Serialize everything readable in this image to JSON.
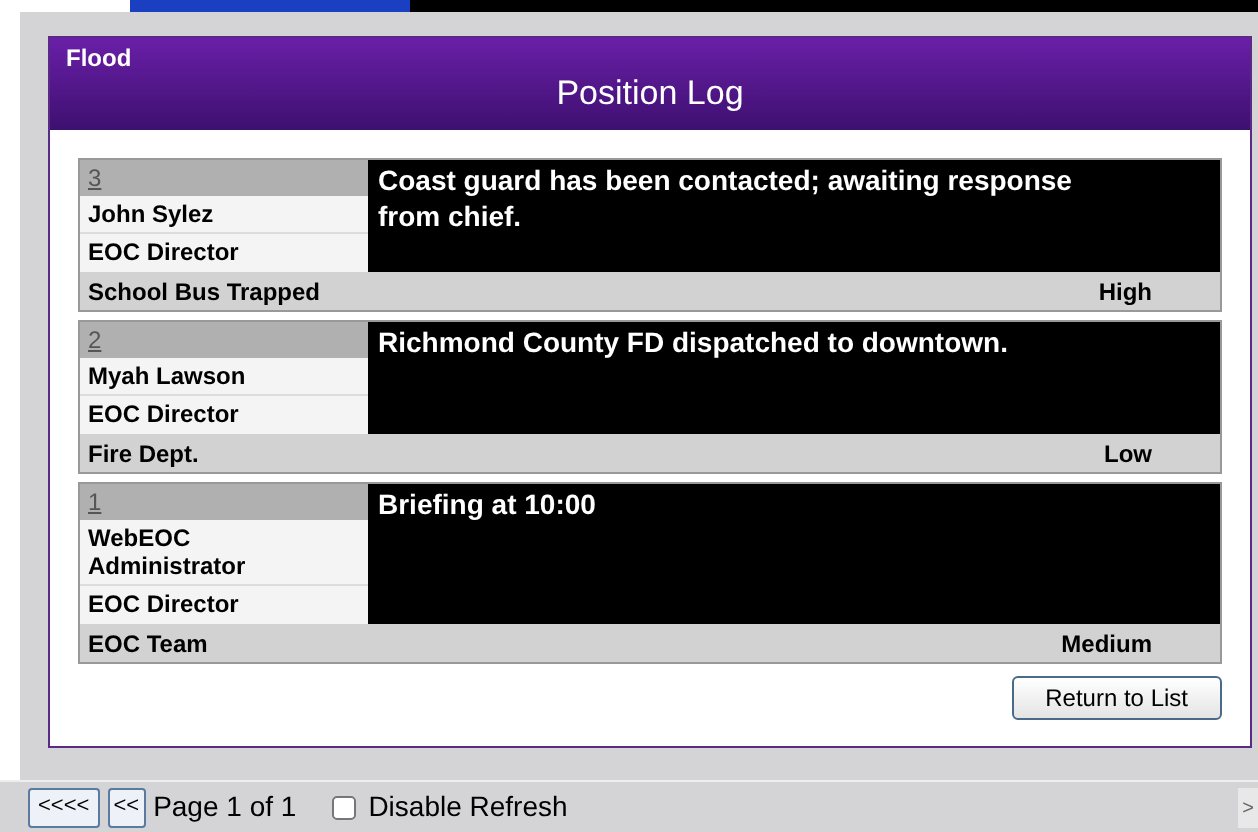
{
  "incident": "Flood",
  "title": "Position Log",
  "entries": [
    {
      "number": "3",
      "name": "John Sylez",
      "role": "EOC Director",
      "message": "Coast guard has been contacted; awaiting response from chief.",
      "category": "School Bus Trapped",
      "priority": "High"
    },
    {
      "number": "2",
      "name": "Myah Lawson",
      "role": "EOC Director",
      "message": "Richmond County FD dispatched to downtown.",
      "category": "Fire Dept.",
      "priority": "Low"
    },
    {
      "number": "1",
      "name": "WebEOC Administrator",
      "role": "EOC Director",
      "message": "Briefing at 10:00",
      "category": "EOC Team",
      "priority": "Medium"
    }
  ],
  "return_button": "Return to List",
  "pager": {
    "first": "<<<<",
    "prev": "<<",
    "page_label": "Page 1 of 1",
    "disable_refresh": {
      "label": "Disable Refresh",
      "checked": false
    },
    "next": ">"
  }
}
